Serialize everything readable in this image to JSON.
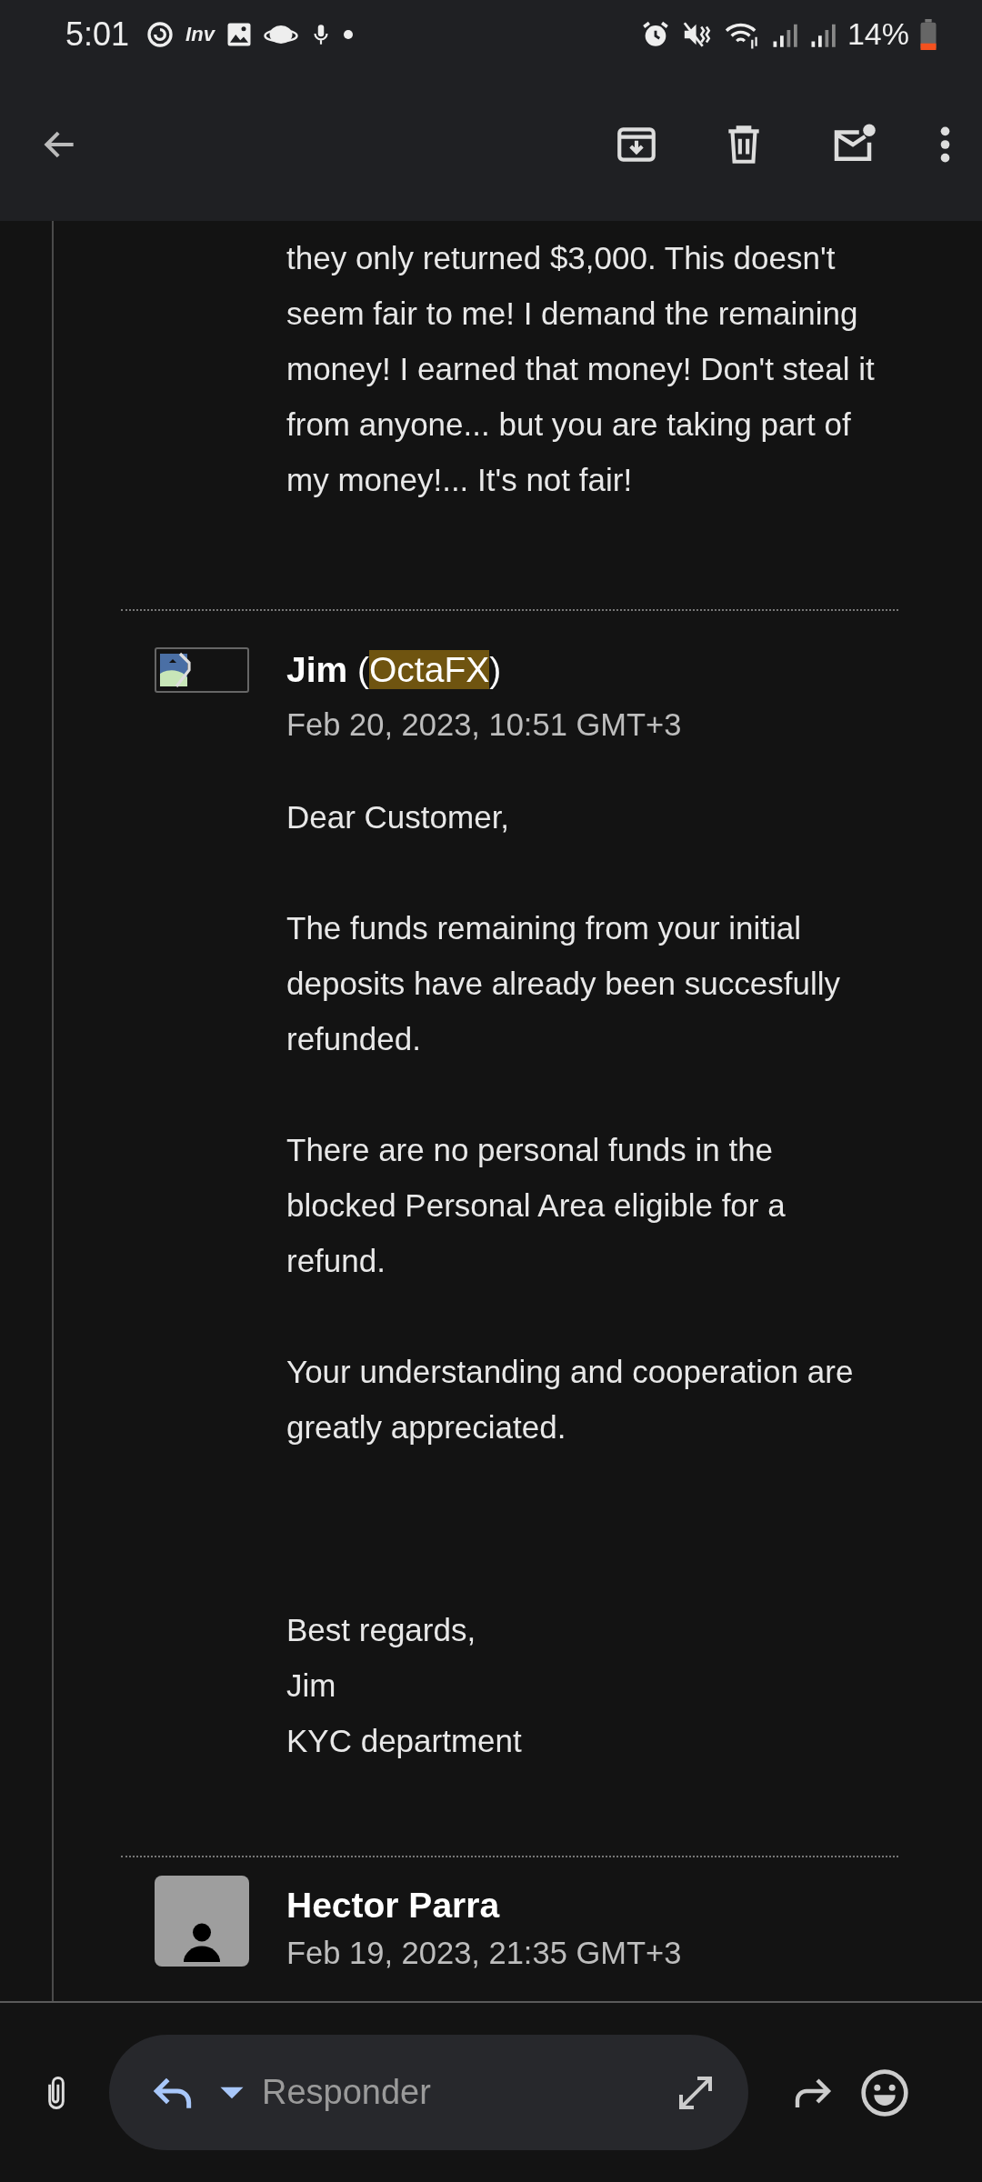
{
  "status_bar": {
    "time": "5:01",
    "notification_text": "Inv",
    "battery": "14%"
  },
  "thread": {
    "messages": [
      {
        "kind": "fragment",
        "paragraphs": [
          {
            "kind": "text",
            "lines": [
              "they only returned $3,000. This doesn't",
              "seem fair to me! I demand the remaining",
              "money! I earned that money! Don't steal it",
              "from anyone... but you are taking part of",
              "my money!... It's not fair!"
            ]
          }
        ]
      },
      {
        "kind": "full",
        "avatar": {
          "kind": "broken-image"
        },
        "sender": {
          "name": "Jim",
          "rest": [
            {
              "text": " (",
              "highlighted": false
            },
            {
              "text": "OctaFX",
              "highlighted": true
            },
            {
              "text": ")",
              "highlighted": false
            }
          ]
        },
        "date": "Feb 20, 2023, 10:51 GMT+3",
        "paragraphs": [
          {
            "kind": "text",
            "lines": [
              "Dear Customer,"
            ]
          },
          {
            "kind": "text",
            "lines": [
              "The funds remaining from your initial",
              "deposits have already been succesfully",
              "refunded."
            ]
          },
          {
            "kind": "text",
            "lines": [
              "There are no personal funds in the",
              "blocked Personal Area eligible for a",
              "refund."
            ]
          },
          {
            "kind": "text",
            "lines": [
              "Your understanding and cooperation are",
              "greatly appreciated."
            ]
          },
          {
            "kind": "signature",
            "lines": [
              "Best regards,",
              "Jim",
              "KYC department"
            ]
          }
        ]
      },
      {
        "kind": "collapsed",
        "avatar": {
          "kind": "person"
        },
        "sender": {
          "name": "Hector Parra"
        },
        "date": "Feb 19, 2023, 21:35 GMT+3"
      }
    ]
  },
  "reply_bar": {
    "placeholder": "Responder"
  }
}
